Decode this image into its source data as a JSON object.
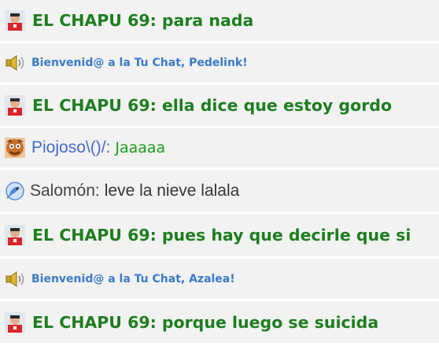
{
  "messages": [
    {
      "user": "EL CHAPU 69:",
      "text": "para nada",
      "avatar_icon": "user-avatar-icon",
      "color": "#1e7d1e"
    },
    {
      "system_text": "Bienvenid@ a la Tu Chat, Pedelink!",
      "icon": "speaker-icon",
      "color": "#3a79c9"
    },
    {
      "user": "EL CHAPU 69:",
      "text": "ella dice que estoy gordo",
      "avatar_icon": "user-avatar-icon",
      "color": "#1e7d1e"
    },
    {
      "user": "Piojoso\\()/:",
      "text": "Jaaaaa",
      "avatar_icon": "character-avatar-icon",
      "name_color": "#4169cf",
      "text_color": "#1aa01a"
    },
    {
      "user": "Salomón:",
      "text": "leve la nieve lalala",
      "avatar_icon": "bird-avatar-icon",
      "name_color": "#444444",
      "text_color": "#333333"
    },
    {
      "user": "EL CHAPU 69:",
      "text": "pues hay que decirle que si",
      "avatar_icon": "user-avatar-icon",
      "color": "#1e7d1e"
    },
    {
      "system_text": "Bienvenid@ a la Tu Chat, Azalea!",
      "icon": "speaker-icon",
      "color": "#3a79c9"
    },
    {
      "user": "EL CHAPU 69:",
      "text": "porque luego se suicida",
      "avatar_icon": "user-avatar-icon",
      "color": "#1e7d1e"
    }
  ]
}
